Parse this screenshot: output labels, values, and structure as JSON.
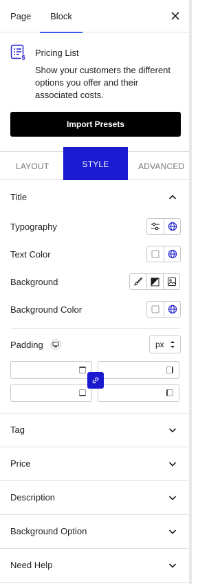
{
  "tabs": {
    "page": "Page",
    "block": "Block"
  },
  "block": {
    "title": "Pricing List",
    "description": "Show your customers the different options you offer and their associated costs."
  },
  "import_button": "Import Presets",
  "sub_tabs": {
    "layout": "LAYOUT",
    "style": "STYLE",
    "advanced": "ADVANCED"
  },
  "title_section": {
    "heading": "Title",
    "typography": "Typography",
    "text_color": "Text Color",
    "background": "Background",
    "background_color": "Background Color",
    "padding": "Padding",
    "unit": "px"
  },
  "sections": [
    "Tag",
    "Price",
    "Description",
    "Background Option",
    "Need Help"
  ],
  "colors": {
    "accent": "#1a1ad1",
    "tab_underline": "#3858e9"
  },
  "icons": {
    "close": "close-icon",
    "block": "pricing-list-icon",
    "typography": "sliders-icon",
    "global": "globe-icon",
    "color": "swatch-icon",
    "brush": "brush-icon",
    "gradient": "gradient-icon",
    "image": "image-icon",
    "device": "desktop-icon",
    "link": "link-icon"
  }
}
